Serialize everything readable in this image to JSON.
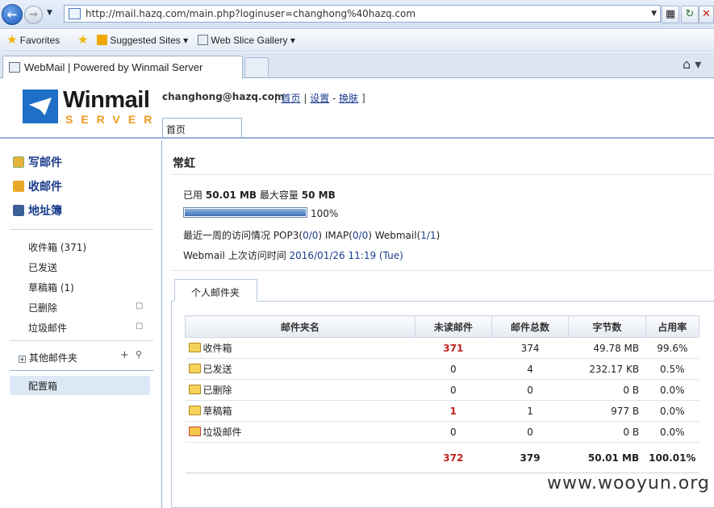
{
  "browser": {
    "url": "http://mail.hazq.com/main.php?loginuser=changhong%40hazq.com",
    "favorites_label": "Favorites",
    "suggested_label": "Suggested Sites",
    "webslice_label": "Web Slice Gallery",
    "tab_title": "WebMail | Powered by Winmail Server"
  },
  "header": {
    "logo_top": "Winmail",
    "logo_bottom": "SERVER",
    "user_email": "changhong@hazq.com",
    "link_home": "首页",
    "link_settings": "设置",
    "link_skin": "换肤",
    "home_tab": "首页"
  },
  "sidebar": {
    "compose": "写邮件",
    "receive": "收邮件",
    "addressbook": "地址簿",
    "folders": [
      {
        "label": "收件箱 (371)",
        "trash": false
      },
      {
        "label": "已发送",
        "trash": false
      },
      {
        "label": "草稿箱 (1)",
        "trash": false
      },
      {
        "label": "已删除",
        "trash": true
      },
      {
        "label": "垃圾邮件",
        "trash": true
      }
    ],
    "other_folders": "其他邮件夹",
    "config_box": "配置箱"
  },
  "main": {
    "title": "常虹",
    "used_prefix": "已用",
    "used_value": "50.01 MB",
    "max_prefix": "最大容量",
    "max_value": "50 MB",
    "usage_percent": "100%",
    "usage_fraction": 1.0,
    "week_prefix": "最近一周的访问情况 POP3(",
    "pop3": "0/0",
    "imap_prefix": ") IMAP(",
    "imap": "0/0",
    "webmail_prefix": ") Webmail(",
    "webmail": "1/1",
    "week_suffix": ")",
    "last_visit_label": "Webmail 上次访问时间",
    "last_visit_time": "2016/01/26 11:19 (Tue)",
    "folder_tab": "个人邮件夹"
  },
  "table": {
    "headers": [
      "邮件夹名",
      "未读邮件",
      "邮件总数",
      "字节数",
      "占用率"
    ],
    "rows": [
      {
        "name": "收件箱",
        "unread": "371",
        "total": "374",
        "bytes": "49.78 MB",
        "rate": "99.6%"
      },
      {
        "name": "已发送",
        "unread": "0",
        "total": "4",
        "bytes": "232.17 KB",
        "rate": "0.5%"
      },
      {
        "name": "已删除",
        "unread": "0",
        "total": "0",
        "bytes": "0 B",
        "rate": "0.0%"
      },
      {
        "name": "草稿箱",
        "unread": "1",
        "total": "1",
        "bytes": "977 B",
        "rate": "0.0%"
      },
      {
        "name": "垃圾邮件",
        "unread": "0",
        "total": "0",
        "bytes": "0 B",
        "rate": "0.0%"
      }
    ],
    "totals": {
      "unread": "372",
      "total": "379",
      "bytes": "50.01 MB",
      "rate": "100.01%"
    }
  },
  "watermark": "www.wooyun.org",
  "colors": {
    "link": "#1a3c8c",
    "unread_red": "#c0221f",
    "accent_border": "#93b1d6",
    "logo_orange": "#f09a1e"
  }
}
